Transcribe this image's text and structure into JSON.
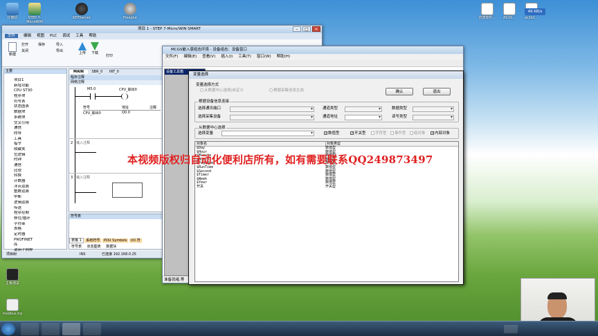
{
  "desktop": {
    "left_icons": [
      "计算机",
      "STEP 7-MicroWIN",
      "KEPServer",
      "Freeglut"
    ],
    "bottom_left_icons": [
      "主板测试",
      "modbus.trp"
    ],
    "top_right_icons": [
      "仿真软件...",
      "ASUS...",
      "ac1b1...",
      "mcgs..."
    ],
    "network_speed": "49 KB/s"
  },
  "step7": {
    "title": "项目 1 - STEP 7-Micro/WIN SMART",
    "menu": [
      "文件",
      "编辑",
      "视图",
      "PLC",
      "调试",
      "工具",
      "帮助"
    ],
    "ribbon_groups": [
      "打开",
      "关闭",
      "保存",
      "导入",
      "导出",
      "上传",
      "下载",
      "打印",
      "新建"
    ],
    "left_panel_title": "主要",
    "tree": [
      "项目1",
      "新增功能",
      "CPU ST30",
      "程序块",
      "符号表",
      "状态图表",
      "数据块",
      "系统块",
      "交叉引用",
      "通信",
      "向导",
      "工具",
      "指令",
      "收藏夹",
      "位逻辑",
      "时钟",
      "通信",
      "比较",
      "转换",
      "计数器",
      "浮点运算",
      "整数运算",
      "中断",
      "逻辑运算",
      "传送",
      "程序控制",
      "移位/循环",
      "字符串",
      "表格",
      "定时器",
      "PROFINET",
      "库",
      "调用子例程"
    ],
    "tabs": [
      "MAIN",
      "SBR_0",
      "INT_0"
    ],
    "network1": {
      "title": "程序注释",
      "rung_label": "网络注释",
      "contact": "M5.0",
      "coil": "CPU_输出0",
      "table_headers": [
        "符号",
        "地址",
        "注释"
      ],
      "table_row": [
        "CPU_输出0",
        "Q0.0",
        ""
      ]
    },
    "network2": {
      "label": "2",
      "comment": "输入注释"
    },
    "network3": {
      "label": "3",
      "comment": "输入注释"
    },
    "symbol_panel_title": "符号表",
    "bottom_tabs": [
      "表格 1",
      "系统符号",
      "POU Symbols",
      "I/O 符"
    ],
    "bottom_tabs2": [
      "符号表",
      "状态图表",
      "数据块"
    ],
    "status": {
      "left": "项目树",
      "ins": "INS",
      "conn": "已连接 192.168.0.25"
    }
  },
  "mcgs": {
    "title": "MCGS嵌入版组态环境 - 设备组态：设备窗口",
    "menu": [
      "文件(F)",
      "编辑(E)",
      "查看(V)",
      "插入(I)",
      "工具(T)",
      "窗口(W)",
      "帮助(H)"
    ],
    "inner_title": "设备工具箱",
    "status": "准备就绪,等"
  },
  "dialog": {
    "title": "变量选择",
    "mode_group": "变量选择方式",
    "radio1": "从数据中心选择|自定义",
    "radio2": "根据采集信息生成",
    "ok_button": "确认",
    "exit_button": "退出",
    "device_group": "根据设备信息连接",
    "labels": {
      "port": "选择通讯端口",
      "channel_type": "通道类型",
      "data_type": "数据类型",
      "device": "选择采集设备",
      "channel_addr": "通道地址",
      "rw_type": "读写类型"
    },
    "dc_group": "从数据中心选择",
    "select_var_label": "选择变量",
    "checks": [
      {
        "label": "数值型",
        "checked": true,
        "disabled": false
      },
      {
        "label": "开关型",
        "checked": true,
        "disabled": false
      },
      {
        "label": "字符型",
        "checked": false,
        "disabled": true
      },
      {
        "label": "事件型",
        "checked": false,
        "disabled": true
      },
      {
        "label": "组对象",
        "checked": false,
        "disabled": true
      },
      {
        "label": "内部对象",
        "checked": true,
        "disabled": false
      }
    ],
    "list_headers": [
      "对象名",
      "对象类型"
    ],
    "rows": [
      [
        "$Day",
        "数值型"
      ],
      [
        "$Hour",
        "数值型"
      ],
      [
        "$Minute",
        "数值型"
      ],
      [
        "$Month",
        "数值型"
      ],
      [
        "$PageNum",
        "数值型"
      ],
      [
        "$RunTime",
        "数值型"
      ],
      [
        "$Second",
        "数值型"
      ],
      [
        "$Timer",
        "数值型"
      ],
      [
        "$Week",
        "数值型"
      ],
      [
        "$Year",
        "数值型"
      ],
      [
        "开关",
        "开关型"
      ]
    ]
  },
  "watermark": "本视频版权归自动化便利店所有，如有需要联系QQ249873497"
}
